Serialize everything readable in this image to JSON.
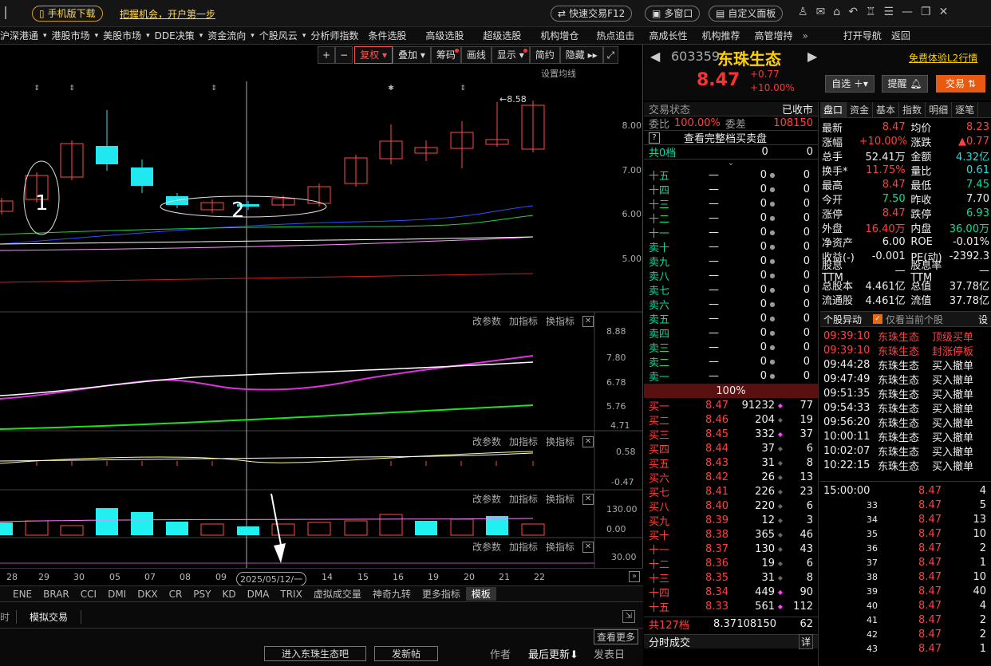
{
  "topbar": {
    "mobile": "手机版下载",
    "slogan": "把握机会，开户第一步",
    "quick": "快速交易F12",
    "multi": "多窗口",
    "custom": "自定义面板"
  },
  "nav": [
    "沪深港通",
    "港股市场",
    "美股市场",
    "DDE决策",
    "资金流向",
    "个股风云",
    "分析师指数",
    "条件选股",
    "高级选股",
    "超级选股",
    "机构增仓",
    "热点追击",
    "高成长性",
    "机构推荐",
    "高管增持",
    "打开导航",
    "返回"
  ],
  "toolbar": {
    "fuquan": "复权",
    "diejia": "叠加",
    "chouma": "筹码",
    "huaxian": "画线",
    "xianshi": "显示",
    "jianyue": "简约",
    "yincang": "隐藏"
  },
  "setma": "设置均线",
  "panel": {
    "gcs": "改参数",
    "jzb": "加指标",
    "hzb": "换指标"
  },
  "price_ticks": [
    "8.00",
    "7.00",
    "6.00",
    "5.00"
  ],
  "peak_label": "8.58",
  "ind1_ticks": [
    "8.88",
    "7.80",
    "6.78",
    "5.76",
    "4.71"
  ],
  "ind2_ticks": [
    "0.58",
    "-0.47"
  ],
  "ind3_ticks": [
    "130.00",
    "0.00"
  ],
  "ind4_ticks": [
    "30.00"
  ],
  "annot": {
    "one": "1",
    "two": "2"
  },
  "xaxis": [
    "28",
    "29",
    "30",
    "05",
    "07",
    "08",
    "09",
    "2025/05/12/一",
    "14",
    "15",
    "16",
    "19",
    "20",
    "21",
    "22"
  ],
  "ind_tabs": [
    "ENE",
    "BRAR",
    "CCI",
    "DMI",
    "DKX",
    "CR",
    "PSY",
    "KD",
    "DMA",
    "TRIX",
    "虚拟成交量",
    "神奇九转",
    "更多指标",
    "模板"
  ],
  "bottom": {
    "sim": "模拟交易",
    "more": "查看更多",
    "enter": "进入东珠生态吧",
    "post": "发新帖",
    "author": "作者",
    "last": "最后更新",
    "send": "发表日"
  },
  "stock": {
    "code": "603359",
    "name": "东珠生态",
    "free": "免费体验L2行情",
    "price": "8.47",
    "chg": "+0.77",
    "pct": "+10.00%",
    "zixuan": "自选",
    "tixing": "提醒",
    "jiaoyi": "交易"
  },
  "status": {
    "label": "交易状态",
    "value": "已收市",
    "weibi_l": "委比",
    "weibi_v": "100.00%",
    "weicha_l": "委差",
    "weicha_v": "108150",
    "full": "查看完整档买卖盘",
    "total0": "共0档",
    "z1": "0",
    "z2": "0"
  },
  "sells": [
    [
      "十五",
      "—",
      "0"
    ],
    [
      "十四",
      "—",
      "0"
    ],
    [
      "十三",
      "—",
      "0"
    ],
    [
      "十二",
      "—",
      "0"
    ],
    [
      "十一",
      "—",
      "0"
    ],
    [
      "卖十",
      "—",
      "0"
    ],
    [
      "卖九",
      "—",
      "0"
    ],
    [
      "卖八",
      "—",
      "0"
    ],
    [
      "卖七",
      "—",
      "0"
    ],
    [
      "卖六",
      "—",
      "0"
    ],
    [
      "卖五",
      "—",
      "0"
    ],
    [
      "卖四",
      "—",
      "0"
    ],
    [
      "卖三",
      "—",
      "0"
    ],
    [
      "卖二",
      "—",
      "0"
    ],
    [
      "卖一",
      "—",
      "0"
    ]
  ],
  "mid_pct": "100%",
  "buys": [
    [
      "买一",
      "8.47",
      "91232",
      "77"
    ],
    [
      "买二",
      "8.46",
      "204",
      "19"
    ],
    [
      "买三",
      "8.45",
      "332",
      "37"
    ],
    [
      "买四",
      "8.44",
      "37",
      "6"
    ],
    [
      "买五",
      "8.43",
      "31",
      "8"
    ],
    [
      "买六",
      "8.42",
      "26",
      "13"
    ],
    [
      "买七",
      "8.41",
      "226",
      "23"
    ],
    [
      "买八",
      "8.40",
      "220",
      "6"
    ],
    [
      "买九",
      "8.39",
      "12",
      "3"
    ],
    [
      "买十",
      "8.38",
      "365",
      "46"
    ],
    [
      "十一",
      "8.37",
      "130",
      "43"
    ],
    [
      "十二",
      "8.36",
      "19",
      "6"
    ],
    [
      "十三",
      "8.35",
      "31",
      "8"
    ],
    [
      "十四",
      "8.34",
      "449",
      "90"
    ],
    [
      "十五",
      "8.33",
      "561",
      "112"
    ]
  ],
  "buy_total": {
    "l": "共127档",
    "p": "8.37",
    "v": "108150",
    "n": "62"
  },
  "fenshi": "分时成交",
  "xiang": "详",
  "tabs": [
    "盘口",
    "资金",
    "基本",
    "指数",
    "明细",
    "逐笔"
  ],
  "stats": [
    [
      "最新",
      "8.47",
      "均价",
      "8.23"
    ],
    [
      "涨幅",
      "+10.00%",
      "涨跌",
      "▲0.77"
    ],
    [
      "总手",
      "52.41万",
      "金额",
      "4.32亿"
    ],
    [
      "换手*",
      "11.75%",
      "量比",
      "0.61"
    ],
    [
      "最高",
      "8.47",
      "最低",
      "7.45"
    ],
    [
      "今开",
      "7.50",
      "昨收",
      "7.70"
    ],
    [
      "涨停",
      "8.47",
      "跌停",
      "6.93"
    ],
    [
      "外盘",
      "16.40万",
      "内盘",
      "36.00万"
    ],
    [
      "净资产",
      "6.00",
      "ROE",
      "-0.01%"
    ],
    [
      "收益(-)",
      "-0.001",
      "PE(动)",
      "-2392.3"
    ],
    [
      "股息TTM",
      "—",
      "股息率TTM",
      "—"
    ],
    [
      "总股本",
      "4.461亿",
      "总值",
      "37.78亿"
    ],
    [
      "流通股",
      "4.461亿",
      "流值",
      "37.78亿"
    ]
  ],
  "yidong": {
    "title": "个股异动",
    "only": "仅看当前个股",
    "set": "设"
  },
  "moves": [
    [
      "09:39:10",
      "东珠生态",
      "顶级买单"
    ],
    [
      "09:39:10",
      "东珠生态",
      "封涨停板"
    ],
    [
      "09:44:28",
      "东珠生态",
      "买入撤单"
    ],
    [
      "09:47:49",
      "东珠生态",
      "买入撤单"
    ],
    [
      "09:51:35",
      "东珠生态",
      "买入撤单"
    ],
    [
      "09:54:33",
      "东珠生态",
      "买入撤单"
    ],
    [
      "09:56:20",
      "东珠生态",
      "买入撤单"
    ],
    [
      "10:00:11",
      "东珠生态",
      "买入撤单"
    ],
    [
      "10:02:07",
      "东珠生态",
      "买入撤单"
    ],
    [
      "10:22:15",
      "东珠生态",
      "买入撤单"
    ]
  ],
  "ticks": [
    [
      "15:00:00",
      "8.47",
      "4"
    ],
    [
      "33",
      "8.47",
      "5"
    ],
    [
      "34",
      "8.47",
      "13"
    ],
    [
      "35",
      "8.47",
      "10"
    ],
    [
      "36",
      "8.47",
      "2"
    ],
    [
      "37",
      "8.47",
      "1"
    ],
    [
      "38",
      "8.47",
      "10"
    ],
    [
      "39",
      "8.47",
      "40"
    ],
    [
      "40",
      "8.47",
      "4"
    ],
    [
      "41",
      "8.47",
      "2"
    ],
    [
      "42",
      "8.47",
      "2"
    ],
    [
      "43",
      "8.47",
      "1"
    ]
  ]
}
